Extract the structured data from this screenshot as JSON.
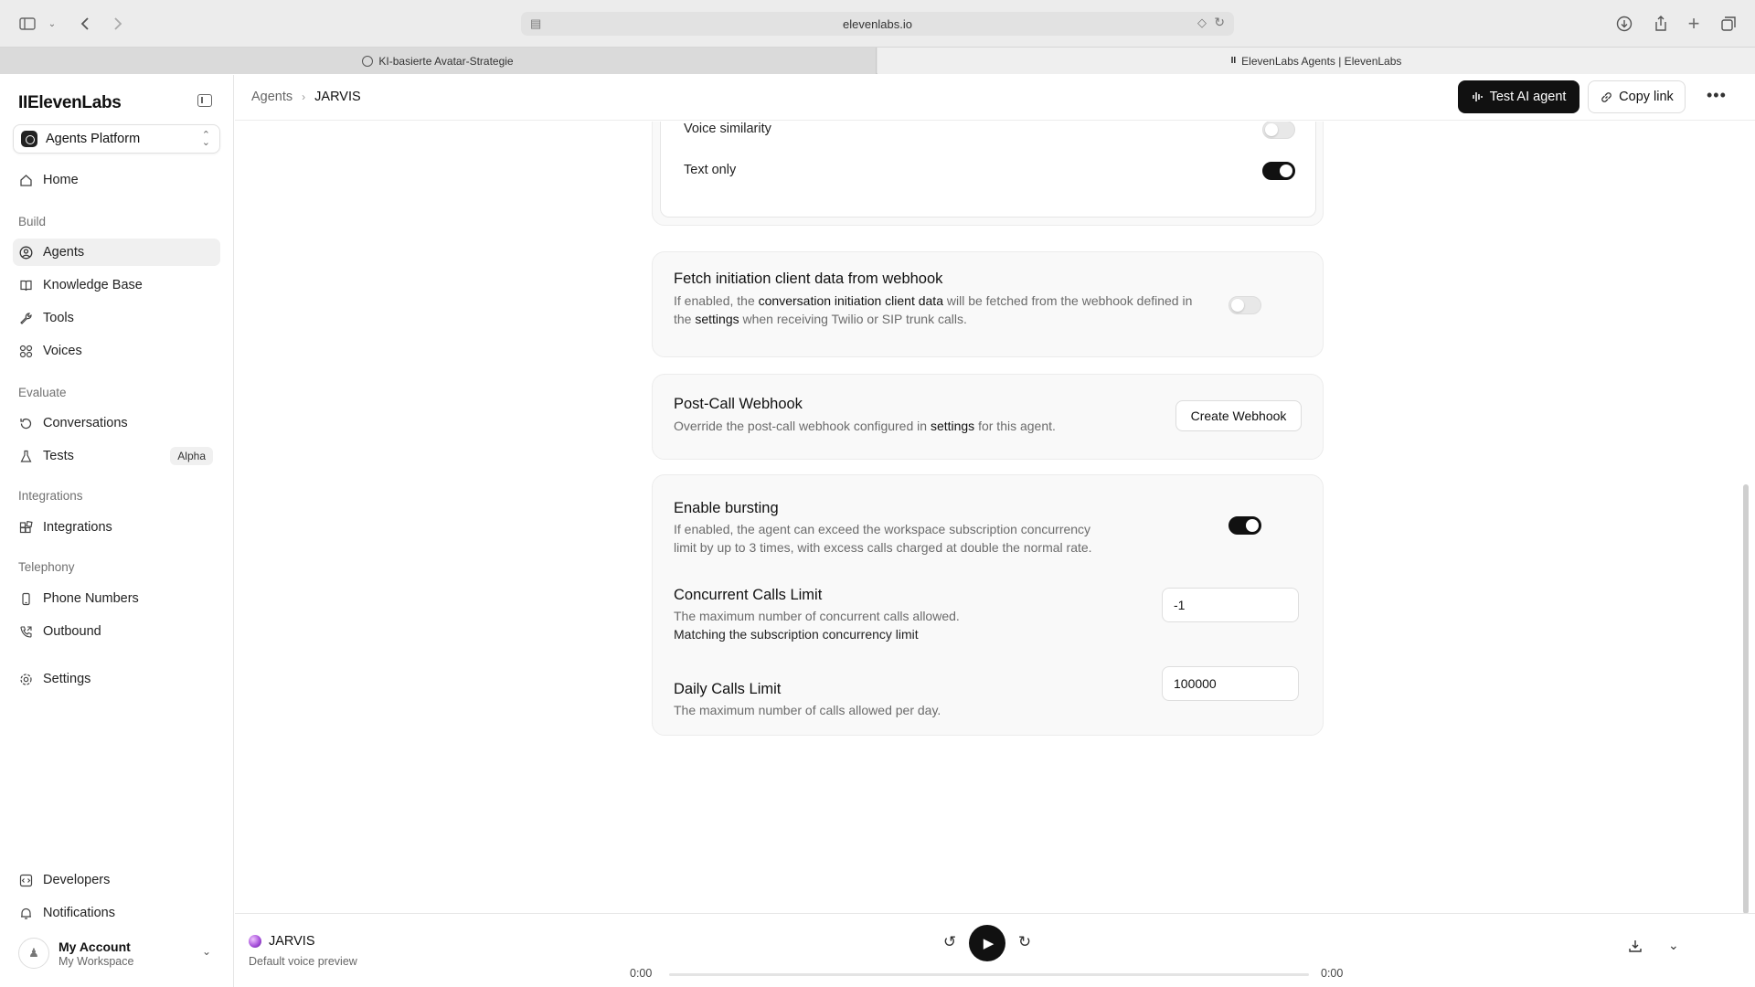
{
  "browser": {
    "url": "elevenlabs.io",
    "tabs": [
      {
        "label": "KI-basierte Avatar-Strategie"
      },
      {
        "label": "ElevenLabs Agents | ElevenLabs"
      }
    ]
  },
  "sidebar": {
    "logo": "IIElevenLabs",
    "platform": "Agents Platform",
    "home": "Home",
    "sections": {
      "build": "Build",
      "evaluate": "Evaluate",
      "integrations": "Integrations",
      "telephony": "Telephony"
    },
    "items": {
      "agents": "Agents",
      "knowledge_base": "Knowledge Base",
      "tools": "Tools",
      "voices": "Voices",
      "conversations": "Conversations",
      "tests": "Tests",
      "tests_badge": "Alpha",
      "integrations": "Integrations",
      "phone_numbers": "Phone Numbers",
      "outbound": "Outbound",
      "settings": "Settings",
      "developers": "Developers",
      "notifications": "Notifications"
    },
    "account": {
      "name": "My Account",
      "workspace": "My Workspace"
    }
  },
  "header": {
    "breadcrumb_root": "Agents",
    "breadcrumb_current": "JARVIS",
    "test_button": "Test AI agent",
    "copy_link_button": "Copy link"
  },
  "settings_card": {
    "voice_similarity": "Voice similarity",
    "voice_similarity_on": false,
    "text_only": "Text only",
    "text_only_on": true
  },
  "webhook_fetch": {
    "title": "Fetch initiation client data from webhook",
    "desc_1": "If enabled, the ",
    "desc_link_1": "conversation initiation client data",
    "desc_2": " will be fetched from the webhook defined in",
    "desc_3": "the ",
    "desc_link_2": "settings",
    "desc_4": " when receiving Twilio or SIP trunk calls.",
    "enabled": false
  },
  "post_call": {
    "title": "Post-Call Webhook",
    "desc_1": "Override the post-call webhook configured in ",
    "desc_link": "settings",
    "desc_2": " for this agent.",
    "button": "Create Webhook"
  },
  "bursting": {
    "title": "Enable bursting",
    "desc_line_1": "If enabled, the agent can exceed the workspace subscription concurrency",
    "desc_line_2": "limit by up to 3 times, with excess calls charged at double the normal rate.",
    "enabled": true,
    "concurrent_title": "Concurrent Calls Limit",
    "concurrent_desc": "The maximum number of concurrent calls allowed.",
    "concurrent_note": "Matching the subscription concurrency limit",
    "concurrent_value": "-1",
    "daily_title": "Daily Calls Limit",
    "daily_desc": "The maximum number of calls allowed per day.",
    "daily_value": "100000"
  },
  "player": {
    "name": "JARVIS",
    "subtitle": "Default voice preview",
    "time_current": "0:00",
    "time_total": "0:00",
    "progress": 0
  },
  "colors": {
    "primary": "#111111",
    "card_bg": "#f9f9f9",
    "muted_text": "#6b6b6b"
  }
}
